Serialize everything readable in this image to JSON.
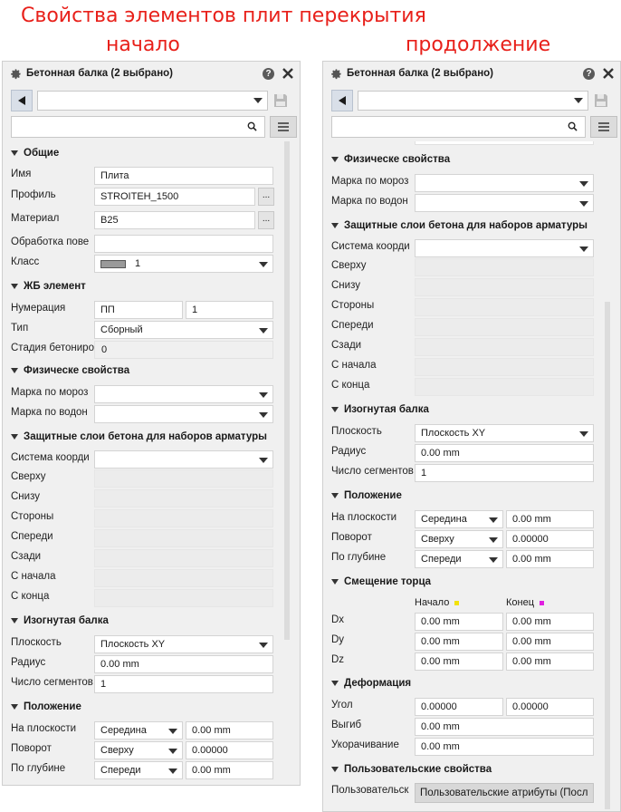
{
  "captions": {
    "title": "Свойства элементов плит перекрытия",
    "left": "начало",
    "right": "продолжение"
  },
  "colors": {
    "caption": "#e8201a",
    "start_marker": "#f2e20a",
    "end_marker": "#e020e0"
  },
  "panel": {
    "title": "Бетонная балка (2 выбрано)",
    "help": "?"
  },
  "left": {
    "general": {
      "header": "Общие",
      "name_label": "Имя",
      "name_value": "Плита",
      "profile_label": "Профиль",
      "profile_value": "STROITEH_1500",
      "material_label": "Материал",
      "material_value": "B25",
      "finish_label": "Обработка пове",
      "class_label": "Класс",
      "class_value": "1",
      "dots": "..."
    },
    "rc": {
      "header": "ЖБ элемент",
      "numbering_label": "Нумерация",
      "numbering_prefix": "ПП",
      "numbering_start": "1",
      "type_label": "Тип",
      "type_value": "Сборный",
      "stage_label": "Стадия бетониро",
      "stage_value": "0"
    },
    "physical": {
      "header": "Физическе свойства",
      "frost_label": "Марка по мороз",
      "water_label": "Марка по водон"
    },
    "cover": {
      "header": "Защитные слои бетона для наборов арматуры",
      "coord_label": "Система коорди",
      "top": "Сверху",
      "bottom": "Снизу",
      "sides": "Стороны",
      "front": "Спереди",
      "back": "Сзади",
      "start": "С начала",
      "end": "С конца"
    },
    "curved": {
      "header": "Изогнутая балка",
      "plane_label": "Плоскость",
      "plane_value": "Плоскость XY",
      "radius_label": "Радиус",
      "radius_value": "0.00 mm",
      "segments_label": "Число сегментов",
      "segments_value": "1"
    },
    "position": {
      "header": "Положение",
      "onplane_label": "На плоскости",
      "onplane_value": "Середина",
      "onplane_offset": "0.00 mm",
      "rotation_label": "Поворот",
      "rotation_value": "Сверху",
      "rotation_offset": "0.00000",
      "depth_label": "По глубине",
      "depth_value": "Спереди",
      "depth_offset": "0.00 mm"
    }
  },
  "right": {
    "physical": {
      "header": "Физическе свойства",
      "frost_label": "Марка по мороз",
      "water_label": "Марка по водон"
    },
    "cover": {
      "header": "Защитные слои бетона для наборов арматуры",
      "coord_label": "Система коорди",
      "top": "Сверху",
      "bottom": "Снизу",
      "sides": "Стороны",
      "front": "Спереди",
      "back": "Сзади",
      "start": "С начала",
      "end": "С конца"
    },
    "curved": {
      "header": "Изогнутая балка",
      "plane_label": "Плоскость",
      "plane_value": "Плоскость XY",
      "radius_label": "Радиус",
      "radius_value": "0.00 mm",
      "segments_label": "Число сегментов",
      "segments_value": "1"
    },
    "position": {
      "header": "Положение",
      "onplane_label": "На плоскости",
      "onplane_value": "Середина",
      "onplane_offset": "0.00 mm",
      "rotation_label": "Поворот",
      "rotation_value": "Сверху",
      "rotation_offset": "0.00000",
      "depth_label": "По глубине",
      "depth_value": "Спереди",
      "depth_offset": "0.00 mm"
    },
    "offset": {
      "header": "Смещение торца",
      "col_start": "Начало",
      "col_end": "Конец",
      "dx_label": "Dx",
      "dy_label": "Dy",
      "dz_label": "Dz",
      "dx_start": "0.00 mm",
      "dx_end": "0.00 mm",
      "dy_start": "0.00 mm",
      "dy_end": "0.00 mm",
      "dz_start": "0.00 mm",
      "dz_end": "0.00 mm"
    },
    "deform": {
      "header": "Деформация",
      "angle_label": "Угол",
      "angle_start": "0.00000",
      "angle_end": "0.00000",
      "bend_label": "Выгиб",
      "bend_value": "0.00 mm",
      "shorten_label": "Укорачивание",
      "shorten_value": "0.00 mm"
    },
    "user": {
      "header": "Пользовательские свойства",
      "label": "Пользовательск",
      "button": "Пользовательские атрибуты (Посл"
    }
  }
}
